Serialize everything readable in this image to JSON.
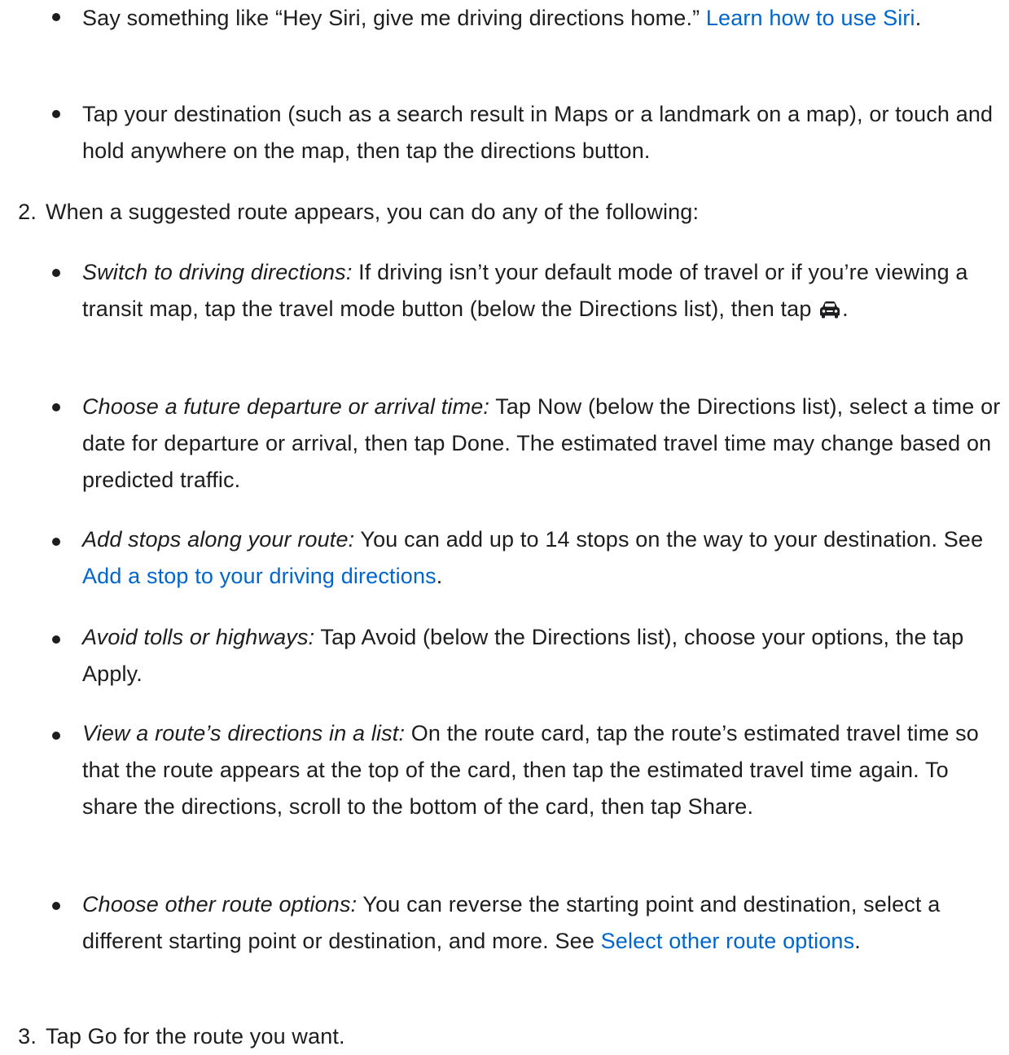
{
  "colors": {
    "text": "#1d1d1f",
    "link": "#0066cc"
  },
  "list": {
    "step1_bullets": {
      "siri": {
        "text": "Say something like “Hey Siri, give me driving directions home.” ",
        "link": "Learn how to use Siri",
        "after": "."
      },
      "tap_destination": {
        "text": "Tap your destination (such as a search result in Maps or a landmark on a map), or touch and hold anywhere on the map, then tap the directions button."
      }
    },
    "step2": {
      "number": "2.",
      "text": "When a suggested route appears, you can do any of the following:",
      "bullets": {
        "switch": {
          "term": "Switch to driving directions:",
          "text_before_icon": " If driving isn’t your default mode of travel or if you’re viewing a transit map, tap the travel mode button (below the Directions list), then tap ",
          "icon": "car-icon",
          "text_after_icon": "."
        },
        "future": {
          "term": "Choose a future departure or arrival time:",
          "text": " Tap Now (below the Directions list), select a time or date for departure or arrival, then tap Done. The estimated travel time may change based on predicted traffic."
        },
        "stops": {
          "term": "Add stops along your route:",
          "text": " You can add up to 14 stops on the way to your destination. See ",
          "link": "Add a stop to your driving directions",
          "after": "."
        },
        "avoid": {
          "term": "Avoid tolls or highways:",
          "text": " Tap Avoid (below the Directions list), choose your options, the tap Apply."
        },
        "view_list": {
          "term": "View a route’s directions in a list:",
          "text": " On the route card, tap the route’s estimated travel time so that the route appears at the top of the card, then tap the estimated travel time again. To share the directions, scroll to the bottom of the card, then tap Share."
        },
        "other": {
          "term": "Choose other route options:",
          "text": " You can reverse the starting point and destination, select a different starting point or destination, and more. See ",
          "link": "Select other route options",
          "after": "."
        }
      }
    },
    "step3": {
      "number": "3.",
      "text": "Tap Go for the route you want."
    }
  }
}
